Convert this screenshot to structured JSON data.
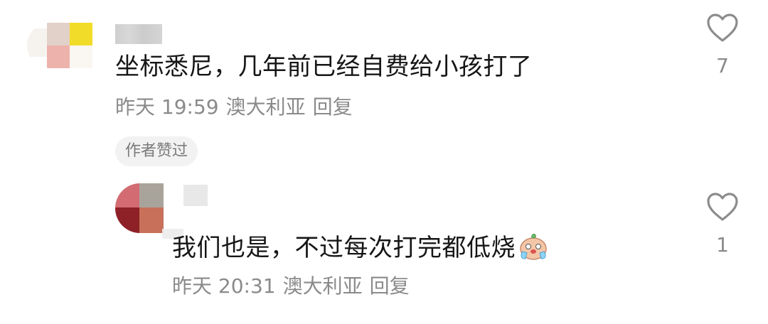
{
  "comments": [
    {
      "text": "坐标悉尼，几年前已经自费给小孩打了",
      "time": "昨天 19:59",
      "location": "澳大利亚",
      "reply_label": "回复",
      "badge": "作者赞过",
      "likes": "7",
      "icons": {
        "like": "heart-outline-icon"
      }
    },
    {
      "text": "我们也是，不过每次打完都低烧",
      "time": "昨天 20:31",
      "location": "澳大利亚",
      "reply_label": "回复",
      "likes": "1",
      "icons": {
        "like": "heart-outline-icon",
        "emoji": "crying-emoji-icon"
      }
    }
  ],
  "colors": {
    "text": "#161616",
    "meta": "#8a8a8a",
    "badge_bg": "#f2f2f2",
    "avatar1": [
      "#e2d1c8",
      "#f2dc2a",
      "#eeb2ad"
    ],
    "avatar2": [
      "#d36b73",
      "#a9a49b",
      "#8e2027",
      "#c8705a"
    ]
  }
}
